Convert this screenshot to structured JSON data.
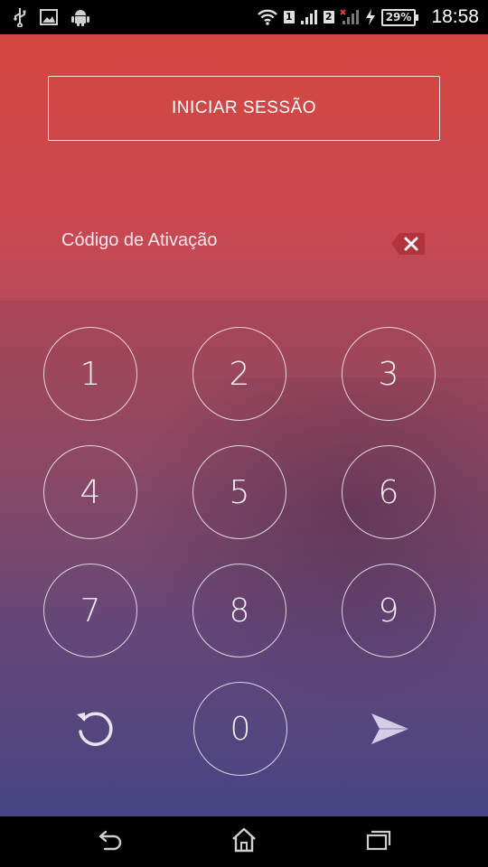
{
  "status_bar": {
    "time": "18:58",
    "battery": "29%",
    "sim1": "1",
    "sim2": "2",
    "icons": [
      "usb-icon",
      "image-icon",
      "android-icon",
      "wifi-icon",
      "signal-icon",
      "charging-icon"
    ]
  },
  "header": {
    "login_label": "INICIAR SESSÃO"
  },
  "activation": {
    "placeholder": "Código de Ativação",
    "clear_icon": "backspace-icon"
  },
  "keypad": {
    "keys": [
      "1",
      "2",
      "3",
      "4",
      "5",
      "6",
      "7",
      "8",
      "9",
      "0"
    ],
    "reset_icon": "refresh-icon",
    "send_icon": "send-icon"
  },
  "nav_bar": {
    "icons": [
      "back-icon",
      "home-icon",
      "recents-icon"
    ]
  },
  "colors": {
    "gradient_top": "#d4473e",
    "gradient_bottom": "#4a4b8d"
  }
}
